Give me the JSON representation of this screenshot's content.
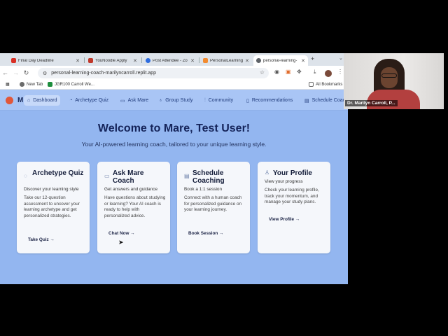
{
  "browser": {
    "tabs": [
      {
        "label": "Final Day Deadline",
        "color": "#d93025"
      },
      {
        "label": "YouNoodle Apply",
        "color": "#c0392b"
      },
      {
        "label": "Post Attendee - Zo",
        "color": "#2d6cdf"
      },
      {
        "label": "PersonalLearningCo",
        "color": "#f28b30"
      },
      {
        "label": "personal-learning-",
        "color": "#5f6368"
      }
    ],
    "active_tab_index": 4,
    "url": "personal-learning-coach-marilyncarroll.replit.app",
    "bookmarks": [
      {
        "label": "New Tab",
        "color": "#6b6b6b"
      },
      {
        "label": "JGR100 Carroll We...",
        "color": "#1e8e3e"
      },
      {
        "label": "All Bookmarks",
        "color": "#6b6b6b"
      }
    ]
  },
  "app": {
    "logo_letter": "M",
    "nav": [
      {
        "label": "Dashboard",
        "icon": "home-icon"
      },
      {
        "label": "Archetype Quiz",
        "icon": "quiz-icon"
      },
      {
        "label": "Ask Mare",
        "icon": "chat-icon"
      },
      {
        "label": "Group Study",
        "icon": "users-icon"
      },
      {
        "label": "Community",
        "icon": "chart-icon"
      },
      {
        "label": "Recommendations",
        "icon": "book-icon"
      },
      {
        "label": "Schedule Coach",
        "icon": "calendar-icon"
      }
    ],
    "hero": {
      "title": "Welcome to Mare, Test User!",
      "subtitle": "Your AI-powered learning coach, tailored to your unique learning style."
    },
    "cards": [
      {
        "icon": "compass-icon",
        "title": "Archetype Quiz",
        "subtitle": "Discover your learning style",
        "description": "Take our 12-question assessment to uncover your learning archetype and get personalized strategies.",
        "link": "Take Quiz →"
      },
      {
        "icon": "chat-icon",
        "title": "Ask Mare Coach",
        "subtitle": "Get answers and guidance",
        "description": "Have questions about studying or learning? Your AI coach is ready to help with personalized advice.",
        "link": "Chat Now →"
      },
      {
        "icon": "calendar-icon",
        "title": "Schedule Coaching",
        "subtitle": "Book a 1:1 session",
        "description": "Connect with a human coach for personalized guidance on your learning journey.",
        "link": "Book Session →"
      },
      {
        "icon": "user-icon",
        "title": "Your Profile",
        "subtitle": "View your progress",
        "description": "Check your learning profile, track your momentum, and manage your study plans.",
        "link": "View Profile →"
      }
    ]
  },
  "video": {
    "participant_name": "Dr. Marilyn Carroll, P..."
  }
}
